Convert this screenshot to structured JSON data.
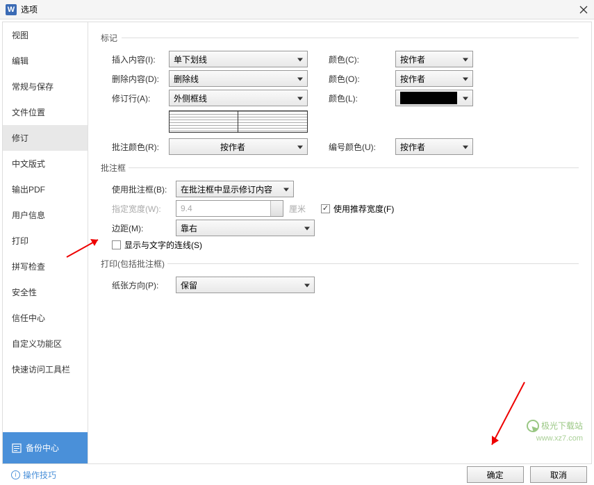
{
  "title": "选项",
  "sidebar": {
    "items": [
      {
        "label": "视图"
      },
      {
        "label": "编辑"
      },
      {
        "label": "常规与保存"
      },
      {
        "label": "文件位置"
      },
      {
        "label": "修订"
      },
      {
        "label": "中文版式"
      },
      {
        "label": "输出PDF"
      },
      {
        "label": "用户信息"
      },
      {
        "label": "打印"
      },
      {
        "label": "拼写检查"
      },
      {
        "label": "安全性"
      },
      {
        "label": "信任中心"
      },
      {
        "label": "自定义功能区"
      },
      {
        "label": "快速访问工具栏"
      }
    ],
    "backup": "备份中心"
  },
  "sections": {
    "mark": {
      "legend": "标记",
      "insert_label": "插入内容(I):",
      "insert_value": "单下划线",
      "delete_label": "删除内容(D):",
      "delete_value": "删除线",
      "revise_label": "修订行(A):",
      "revise_value": "外侧框线",
      "color_c": "颜色(C):",
      "color_o": "颜色(O):",
      "color_l": "颜色(L):",
      "author_value": "按作者",
      "comment_color_label": "批注颜色(R):",
      "comment_color_value": "按作者",
      "number_color_label": "编号颜色(U):",
      "number_color_value": "按作者"
    },
    "comment_box": {
      "legend": "批注框",
      "use_label": "使用批注框(B):",
      "use_value": "在批注框中显示修订内容",
      "width_label": "指定宽度(W):",
      "width_value": "9.4",
      "width_unit": "厘米",
      "recommend_label": "使用推荐宽度(F)",
      "margin_label": "边距(M):",
      "margin_value": "靠右",
      "show_line_label": "显示与文字的连线(S)"
    },
    "print": {
      "legend": "打印(包括批注框)",
      "paper_label": "纸张方向(P):",
      "paper_value": "保留"
    }
  },
  "footer": {
    "tips": "操作技巧",
    "ok": "确定",
    "cancel": "取消"
  },
  "watermark": {
    "main": "极光下载站",
    "sub": "www.xz7.com"
  }
}
